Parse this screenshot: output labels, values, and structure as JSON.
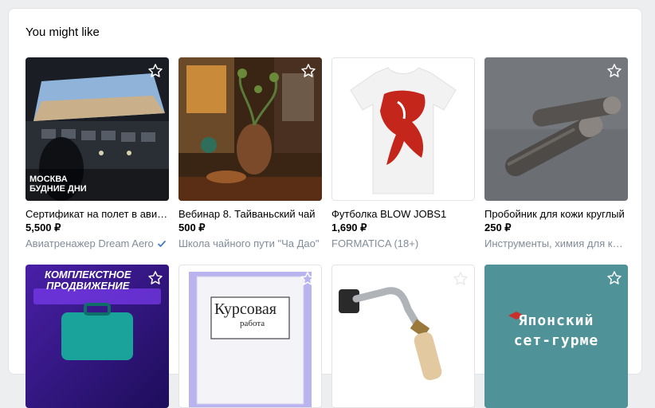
{
  "section": {
    "title": "You might like"
  },
  "colors": {
    "accent": "#447bba",
    "muted": "#818c99",
    "star": "#ffffff"
  },
  "products": [
    {
      "name": "Сертификат на полет в авиатренажере",
      "price": "5,500 ₽",
      "seller": "Авиатренажер Dream Aero",
      "verified": true,
      "overlay": [
        "МОСКВА",
        "БУДНИЕ ДНИ"
      ]
    },
    {
      "name": "Вебинар 8. Тайваньский чай",
      "price": "500 ₽",
      "seller": "Школа чайного пути \"Ча Дао\"",
      "verified": false
    },
    {
      "name": "Футболка BLOW JOBS1",
      "price": "1,690 ₽",
      "seller": "FORMATICA (18+)",
      "verified": false
    },
    {
      "name": "Пробойник для кожи круглый",
      "price": "250 ₽",
      "seller": "Инструменты, химия для кожи",
      "verified": false
    },
    {
      "name": "",
      "price": "",
      "seller": "",
      "overlay": [
        "КОМПЛЕКСТНОЕ",
        "ПРОДВИЖЕНИЕ"
      ]
    },
    {
      "name": "",
      "price": "",
      "seller": "",
      "overlay": [
        "Курсовая",
        "работа"
      ]
    },
    {
      "name": "",
      "price": "",
      "seller": ""
    },
    {
      "name": "",
      "price": "",
      "seller": "",
      "overlay": [
        "Японский",
        "сет-гурме"
      ]
    }
  ]
}
